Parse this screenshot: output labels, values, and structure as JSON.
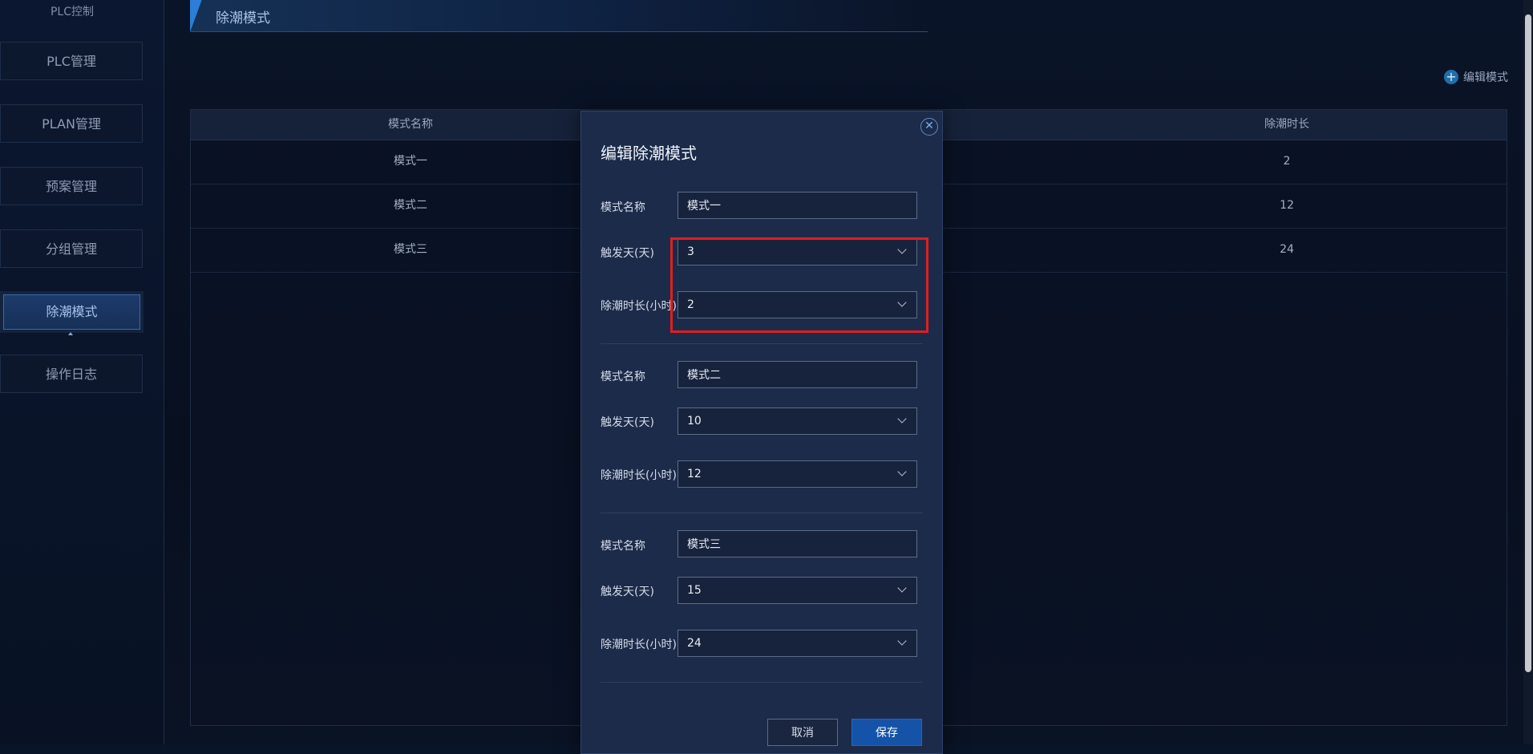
{
  "sidebar": {
    "title": "PLC控制",
    "items": [
      {
        "label": "PLC管理",
        "active": false
      },
      {
        "label": "PLAN管理",
        "active": false
      },
      {
        "label": "预案管理",
        "active": false
      },
      {
        "label": "分组管理",
        "active": false
      },
      {
        "label": "除潮模式",
        "active": true
      },
      {
        "label": "操作日志",
        "active": false
      }
    ]
  },
  "header": {
    "title": "除潮模式"
  },
  "toolbar": {
    "edit_label": "编辑模式",
    "edit_icon": "plus-circle-icon"
  },
  "table": {
    "columns": [
      "模式名称",
      "除潮时长"
    ],
    "rows": [
      [
        "模式一",
        "2"
      ],
      [
        "模式二",
        "12"
      ],
      [
        "模式三",
        "24"
      ]
    ]
  },
  "modal": {
    "title": "编辑除潮模式",
    "close_icon": "close-icon",
    "groups": [
      {
        "name_label": "模式名称",
        "name_value": "模式一",
        "trigger_label": "触发天(天)",
        "trigger_value": "3",
        "duration_label": "除潮时长(小时)",
        "duration_value": "2"
      },
      {
        "name_label": "模式名称",
        "name_value": "模式二",
        "trigger_label": "触发天(天)",
        "trigger_value": "10",
        "duration_label": "除潮时长(小时)",
        "duration_value": "12"
      },
      {
        "name_label": "模式名称",
        "name_value": "模式三",
        "trigger_label": "触发天(天)",
        "trigger_value": "15",
        "duration_label": "除潮时长(小时)",
        "duration_value": "24"
      }
    ],
    "cancel_label": "取消",
    "save_label": "保存"
  },
  "colors": {
    "background": "#0a1428",
    "modal": "#1d2b4a",
    "primary": "#1453a8",
    "highlight": "#e01e1e"
  }
}
